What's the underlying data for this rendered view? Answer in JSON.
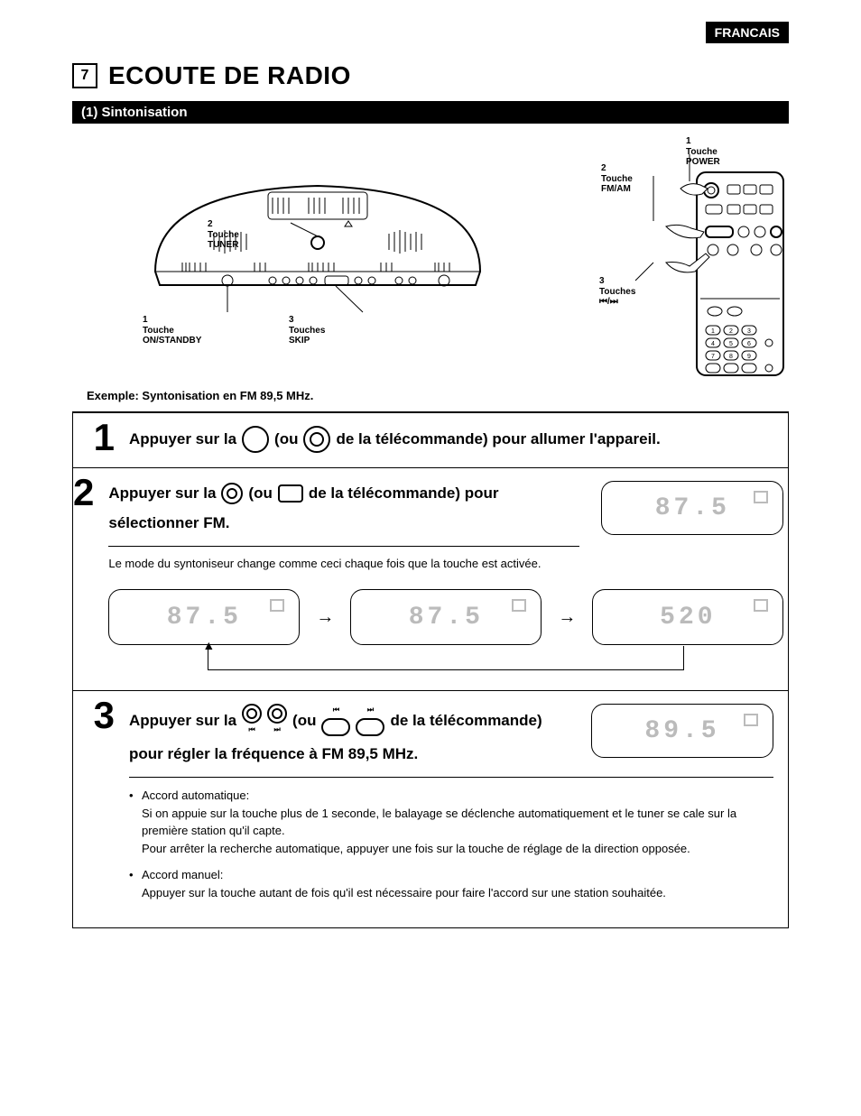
{
  "lang_badge": "FRANCAIS",
  "section_number": "7",
  "section_title": "ECOUTE DE RADIO",
  "subsection": "(1) Sintonisation",
  "device_labels": {
    "l1_num": "1",
    "l1_a": "Touche",
    "l1_b": "ON/STANDBY",
    "l2_num": "2",
    "l2_a": "Touche",
    "l2_b": "TUNER",
    "l3_num": "3",
    "l3_a": "Touches",
    "l3_b": "SKIP"
  },
  "remote_labels": {
    "r1_num": "1",
    "r1_a": "Touche",
    "r1_b": "POWER",
    "r2_num": "2",
    "r2_a": "Touche",
    "r2_b": "FM/AM",
    "r3_num": "3",
    "r3_a": "Touches",
    "r3_b": "⏮/⏭"
  },
  "example": "Exemple: Syntonisation en FM 89,5 MHz.",
  "steps": {
    "s1": {
      "num": "1",
      "t1": "Appuyer sur la",
      "t2": "(ou",
      "t3": "de la télécommande) pour allumer l'appareil."
    },
    "s2": {
      "num": "2",
      "t1": "Appuyer sur la",
      "t2": "(ou",
      "t3": "de la télécommande) pour",
      "t4": "sélectionner FM.",
      "note": "Le mode du syntoniseur change comme ceci chaque fois que la touche est activée.",
      "lcd_side": "87.5",
      "cycle": {
        "a": "87.5",
        "b": "87.5",
        "c": "520"
      }
    },
    "s3": {
      "num": "3",
      "t1": "Appuyer sur la",
      "t2": "(ou",
      "t3": "de la télécommande)",
      "t4": "pour régler la fréquence à FM 89,5 MHz.",
      "lcd_side": "89.5",
      "bullet1_title": "Accord automatique:",
      "bullet1_a": "Si on appuie sur la touche plus de 1 seconde, le balayage se déclenche automatiquement et le tuner se cale sur la première station qu'il capte.",
      "bullet1_b": "Pour arrêter la recherche automatique, appuyer une fois sur la touche de réglage de la direction opposée.",
      "bullet2_title": "Accord manuel:",
      "bullet2_a": "Appuyer sur la touche autant de fois qu'il est nécessaire pour faire l'accord sur une station souhaitée."
    }
  }
}
